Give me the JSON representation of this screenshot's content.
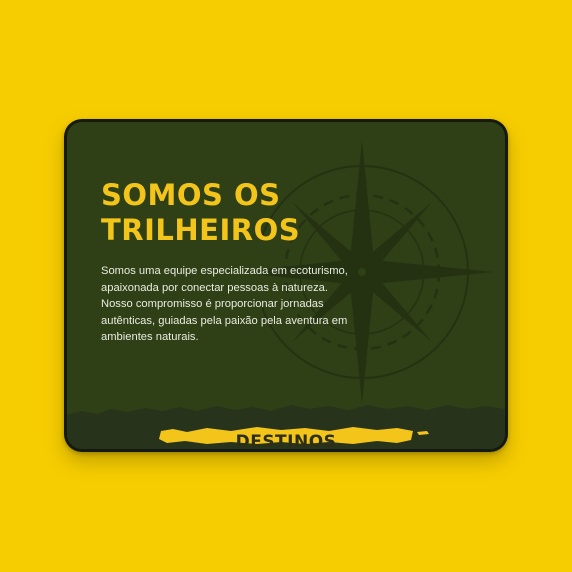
{
  "hero": {
    "title_line1": "SOMOS OS",
    "title_line2": "TRILHEIROS",
    "description": "Somos uma equipe especializada em ecoturismo, apaixonada por conectar pessoas à natureza. Nosso compromisso é proporcionar jornadas autênticas, guiadas pela paixão pela aventura em ambientes naturais."
  },
  "next_section": {
    "heading": "DESTINOS"
  },
  "decor": {
    "background_icon": "compass-rose-icon"
  },
  "colors": {
    "page_background": "#f6cd00",
    "device_frame": "#141a12",
    "screen_background": "#2f4017",
    "accent_yellow": "#f3c51a",
    "compass_stroke": "#243212",
    "ground_band": "#27331a",
    "body_text": "#e9ecdf"
  }
}
